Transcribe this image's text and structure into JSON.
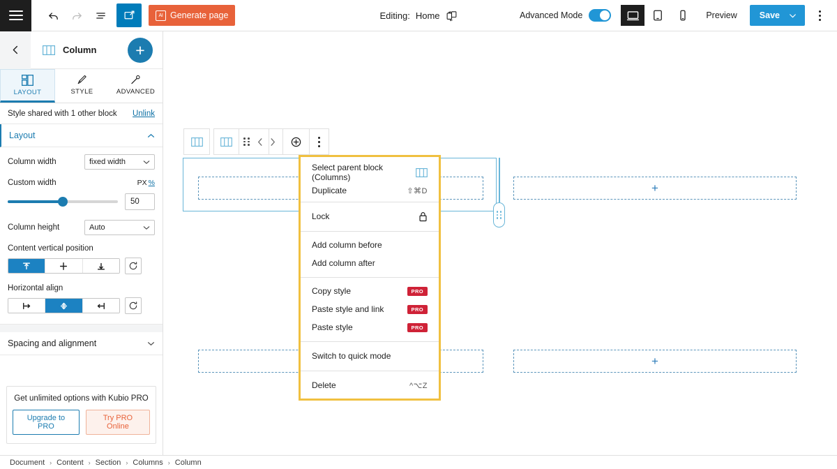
{
  "topbar": {
    "menu_icon": "hamburger-icon",
    "undo_label": "Undo",
    "redo_label": "Redo",
    "list_view_label": "List view",
    "edit_icon_label": "Edit",
    "generate_page_label": "Generate page",
    "generate_page_badge": "AI",
    "editing_prefix": "Editing:",
    "editing_page": "Home",
    "swap_template_label": "Swap template",
    "advanced_mode_label": "Advanced Mode",
    "advanced_mode_on": true,
    "device_desktop_label": "Desktop",
    "device_tablet_label": "Tablet",
    "device_mobile_label": "Mobile",
    "preview_label": "Preview",
    "save_label": "Save",
    "options_label": "Options"
  },
  "sidebar": {
    "back_label": "Back",
    "block_icon": "columns-icon",
    "block_title": "Column",
    "add_block_label": "+",
    "tabs": [
      {
        "label": "LAYOUT",
        "icon": "layout-icon",
        "active": true
      },
      {
        "label": "STYLE",
        "icon": "brush-icon",
        "active": false
      },
      {
        "label": "ADVANCED",
        "icon": "wrench-icon",
        "active": false
      }
    ],
    "shared_notice": "Style shared with 1 other block",
    "unlink_label": "Unlink",
    "layout_section": {
      "title": "Layout",
      "expanded": true,
      "column_width_label": "Column width",
      "column_width_value": "fixed width",
      "custom_width_label": "Custom width",
      "unit_px": "PX",
      "unit_pct": "%",
      "custom_width_value": "50",
      "column_height_label": "Column height",
      "column_height_value": "Auto",
      "vertical_position_label": "Content vertical position",
      "vertical_options": [
        "top",
        "middle",
        "bottom"
      ],
      "vertical_selected": 0,
      "horizontal_label": "Horizontal align",
      "horizontal_options": [
        "left",
        "center",
        "right"
      ],
      "horizontal_selected": 1,
      "reset_label": "Reset"
    },
    "spacing_section": {
      "title": "Spacing and alignment",
      "expanded": false
    },
    "promo": {
      "text": "Get unlimited options with Kubio PRO",
      "upgrade_label": "Upgrade to PRO",
      "try_label": "Try PRO Online"
    }
  },
  "canvas": {
    "toolbar": {
      "parent_block_label": "Parent block",
      "block_type_label": "Column",
      "drag_label": "Drag",
      "move_up_label": "Move up",
      "move_down_label": "Move down",
      "add_label": "Add block",
      "more_label": "Options"
    },
    "placeholders": [
      {
        "label": "+"
      },
      {
        "label": "+"
      },
      {
        "label": "+"
      },
      {
        "label": "+"
      }
    ]
  },
  "context_menu": {
    "groups": [
      {
        "items": [
          {
            "label": "Select parent block (Columns)",
            "shortcut": "",
            "icon": "columns-icon",
            "pro": false
          },
          {
            "label": "Duplicate",
            "shortcut": "⇧⌘D",
            "icon": "",
            "pro": false
          }
        ]
      },
      {
        "items": [
          {
            "label": "Lock",
            "shortcut": "",
            "icon": "lock-icon",
            "pro": false
          }
        ]
      },
      {
        "items": [
          {
            "label": "Add column before",
            "shortcut": "",
            "icon": "",
            "pro": false
          },
          {
            "label": "Add column after",
            "shortcut": "",
            "icon": "",
            "pro": false
          }
        ]
      },
      {
        "items": [
          {
            "label": "Copy style",
            "shortcut": "",
            "icon": "",
            "pro": true
          },
          {
            "label": "Paste style and link",
            "shortcut": "",
            "icon": "",
            "pro": true
          },
          {
            "label": "Paste style",
            "shortcut": "",
            "icon": "",
            "pro": true
          }
        ]
      },
      {
        "items": [
          {
            "label": "Switch to quick mode",
            "shortcut": "",
            "icon": "",
            "pro": false
          }
        ]
      },
      {
        "items": [
          {
            "label": "Delete",
            "shortcut": "^⌥Z",
            "icon": "",
            "pro": false
          }
        ]
      }
    ],
    "pro_badge": "PRO"
  },
  "footer": {
    "breadcrumbs": [
      "Document",
      "Content",
      "Section",
      "Columns",
      "Column"
    ],
    "separator": "›"
  },
  "colors": {
    "accent_blue": "#1c7cb0",
    "toggle_blue": "#2196d6",
    "orange": "#e8623a",
    "pro_red": "#cf2237",
    "highlight_yellow": "#f0c040",
    "block_outline": "#68b5d8"
  }
}
